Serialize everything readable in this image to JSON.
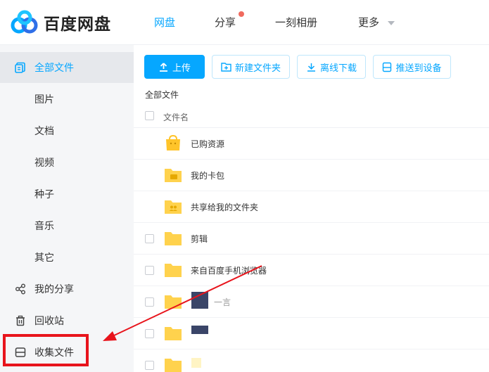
{
  "header": {
    "brand": "百度网盘",
    "nav": [
      {
        "label": "网盘",
        "active": true
      },
      {
        "label": "分享",
        "active": false,
        "has_dot": true
      },
      {
        "label": "一刻相册",
        "active": false
      },
      {
        "label": "更多",
        "active": false,
        "has_caret": true
      }
    ]
  },
  "sidebar": {
    "items": [
      {
        "label": "全部文件",
        "icon": "all-files-icon",
        "active": true
      },
      {
        "label": "图片"
      },
      {
        "label": "文档"
      },
      {
        "label": "视频"
      },
      {
        "label": "种子"
      },
      {
        "label": "音乐"
      },
      {
        "label": "其它"
      },
      {
        "label": "我的分享",
        "icon": "share-icon"
      },
      {
        "label": "回收站",
        "icon": "trash-icon"
      },
      {
        "label": "收集文件",
        "icon": "collect-icon"
      }
    ]
  },
  "toolbar": {
    "upload": "上传",
    "new_folder": "新建文件夹",
    "offline_download": "离线下载",
    "push_device": "推送到设备"
  },
  "breadcrumb": "全部文件",
  "list": {
    "header_name": "文件名",
    "rows": [
      {
        "name": "已购资源",
        "icon": "purchased-folder-icon"
      },
      {
        "name": "我的卡包",
        "icon": "card-folder-icon"
      },
      {
        "name": "共享给我的文件夹",
        "icon": "shared-folder-icon"
      },
      {
        "name": "剪辑",
        "icon": "folder-icon"
      },
      {
        "name": "来自百度手机浏览器",
        "icon": "folder-icon"
      },
      {
        "name": "一言",
        "icon": "folder-icon"
      },
      {
        "name": "",
        "icon": "folder-icon"
      },
      {
        "name": "",
        "icon": "folder-icon"
      }
    ]
  },
  "colors": {
    "accent": "#06a7ff",
    "annotation_red": "#e8141c",
    "folder": "#ffd24d"
  }
}
